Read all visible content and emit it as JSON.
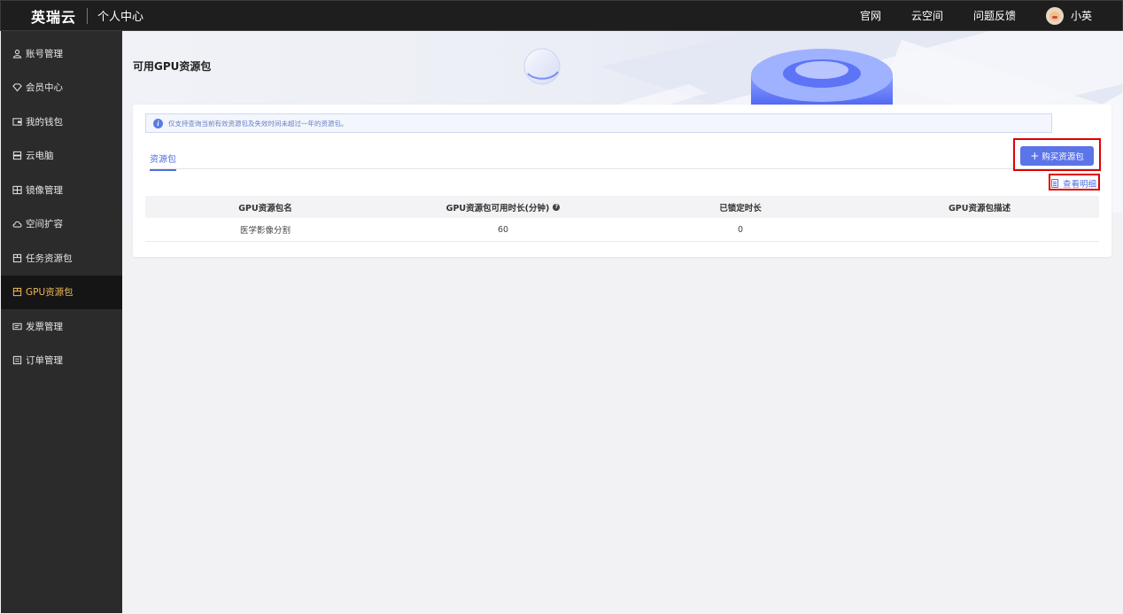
{
  "topbar": {
    "brand": "英瑞云",
    "subtitle": "个人中心",
    "nav": [
      "官网",
      "云空间",
      "问题反馈"
    ],
    "user_name": "小英"
  },
  "sidebar": {
    "items": [
      {
        "label": "账号管理",
        "icon": "user-icon"
      },
      {
        "label": "会员中心",
        "icon": "diamond-icon"
      },
      {
        "label": "我的钱包",
        "icon": "wallet-icon"
      },
      {
        "label": "云电脑",
        "icon": "server-icon"
      },
      {
        "label": "镜像管理",
        "icon": "image-icon"
      },
      {
        "label": "空间扩容",
        "icon": "cloud-icon"
      },
      {
        "label": "任务资源包",
        "icon": "package-icon"
      },
      {
        "label": "GPU资源包",
        "icon": "package-icon",
        "active": true
      },
      {
        "label": "发票管理",
        "icon": "ticket-icon"
      },
      {
        "label": "订单管理",
        "icon": "list-icon"
      }
    ]
  },
  "main": {
    "page_title": "可用GPU资源包",
    "notice": "仅支持查询当前有效资源包及失效时间未超过一年的资源包。",
    "tab_label": "资源包",
    "buy_button": "购买资源包",
    "detail_link": "查看明细",
    "table": {
      "headers": [
        "GPU资源包名",
        "GPU资源包可用时长(分钟)",
        "已锁定时长",
        "GPU资源包描述"
      ],
      "rows": [
        [
          "医学影像分割",
          "60",
          "0",
          ""
        ]
      ]
    }
  },
  "colors": {
    "accent": "#5b74e8",
    "sidebar_active_text": "#f0b85a",
    "highlight_box": "#e00000"
  }
}
